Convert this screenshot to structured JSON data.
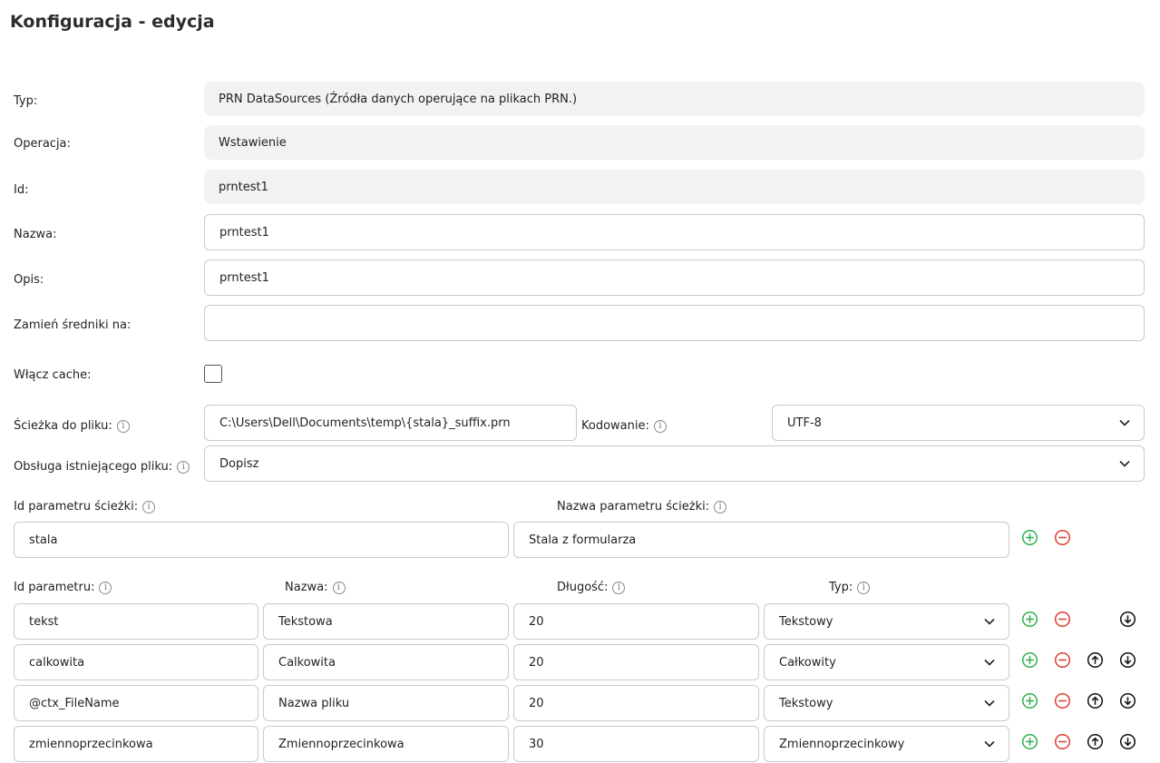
{
  "page": {
    "title": "Konfiguracja - edycja"
  },
  "form": {
    "typ": {
      "label": "Typ:",
      "value": "PRN DataSources (Źródła danych operujące na plikach PRN.)"
    },
    "operacja": {
      "label": "Operacja:",
      "value": "Wstawienie"
    },
    "id": {
      "label": "Id:",
      "value": "prntest1"
    },
    "nazwa": {
      "label": "Nazwa:",
      "value": "prntest1"
    },
    "opis": {
      "label": "Opis:",
      "value": "prntest1"
    },
    "zamien": {
      "label": "Zamień średniki na:",
      "value": ""
    },
    "cache": {
      "label": "Włącz cache:",
      "checked": false
    },
    "sciezka": {
      "label": "Ścieżka do pliku:",
      "value": "C:\\Users\\Dell\\Documents\\temp\\{stala}_suffix.prn"
    },
    "kodowanie": {
      "label": "Kodowanie:",
      "value": "UTF-8"
    },
    "obsluga": {
      "label": "Obsługa istniejącego pliku:",
      "value": "Dopisz"
    }
  },
  "path_params": {
    "id_label": "Id parametru ścieżki:",
    "name_label": "Nazwa parametru ścieżki:",
    "rows": [
      {
        "id": "stala",
        "name": "Stala z formularza"
      }
    ]
  },
  "params": {
    "headers": {
      "id": "Id parametru:",
      "name": "Nazwa:",
      "length": "Długość:",
      "type": "Typ:"
    },
    "rows": [
      {
        "id": "tekst",
        "name": "Tekstowa",
        "length": "20",
        "type": "Tekstowy"
      },
      {
        "id": "calkowita",
        "name": "Calkowita",
        "length": "20",
        "type": "Całkowity"
      },
      {
        "id": "@ctx_FileName",
        "name": "Nazwa pliku",
        "length": "20",
        "type": "Tekstowy"
      },
      {
        "id": "zmiennoprzecinkowa",
        "name": "Zmiennoprzecinkowa",
        "length": "30",
        "type": "Zmiennoprzecinkowy"
      }
    ]
  },
  "icons": {
    "info": "info-icon",
    "chevron": "chevron-down-icon",
    "add": "plus-circle-icon",
    "remove": "minus-circle-icon",
    "up": "arrow-up-circle-icon",
    "down": "arrow-down-circle-icon"
  },
  "colors": {
    "add": "#2db24a",
    "remove": "#e03c31",
    "move": "#111111",
    "readonly_bg": "#f1f2f2",
    "border": "#c9c9c9"
  }
}
